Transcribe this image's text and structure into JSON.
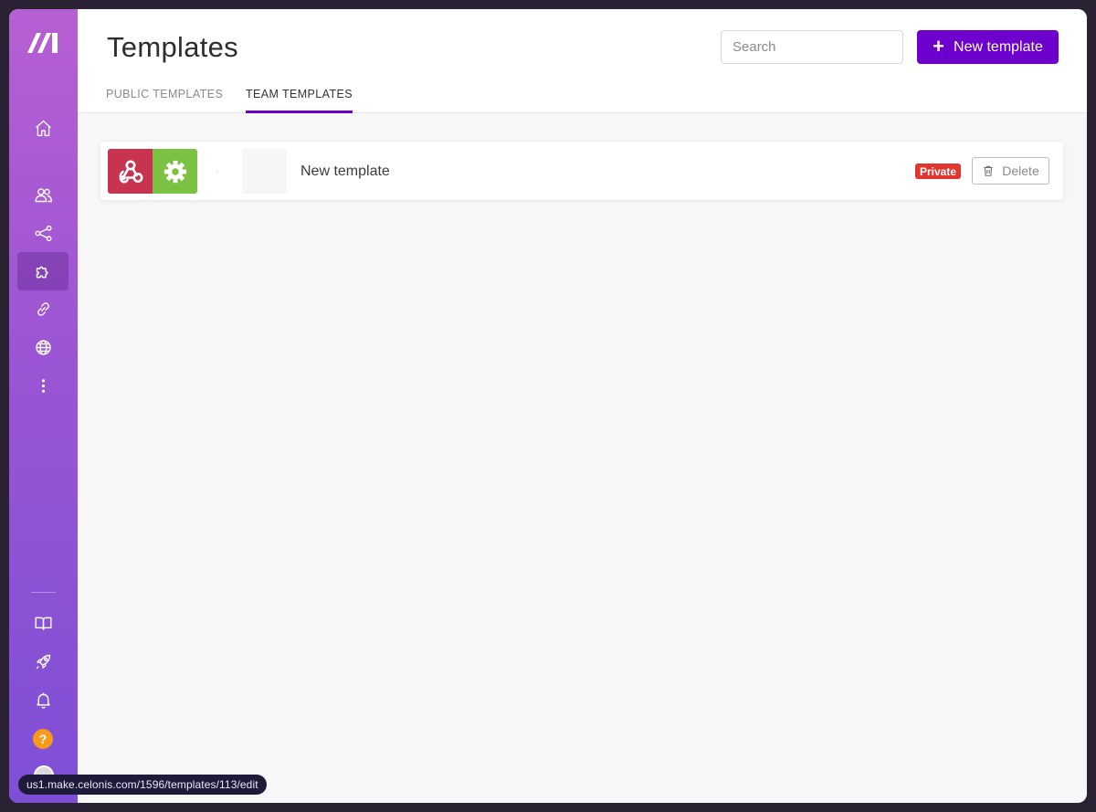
{
  "header": {
    "title": "Templates",
    "search_placeholder": "Search",
    "new_button_label": "New template"
  },
  "tabs": [
    {
      "label": "PUBLIC TEMPLATES",
      "active": false
    },
    {
      "label": "TEAM TEMPLATES",
      "active": true
    }
  ],
  "sidebar": {
    "items": [
      {
        "icon": "home-icon"
      },
      {
        "icon": "team-icon"
      },
      {
        "icon": "scenarios-icon"
      },
      {
        "icon": "templates-puzzle-icon",
        "active": true
      },
      {
        "icon": "connections-link-icon"
      },
      {
        "icon": "webhooks-globe-icon"
      },
      {
        "icon": "more-vertical-icon"
      }
    ],
    "bottom_items": [
      {
        "icon": "docs-book-icon"
      },
      {
        "icon": "rocket-icon"
      },
      {
        "icon": "bell-icon"
      },
      {
        "icon": "help-icon",
        "label": "?"
      }
    ]
  },
  "templates": [
    {
      "name": "New template",
      "apps": [
        "webhooks-icon",
        "tools-gear-icon"
      ],
      "visibility": "Private",
      "delete_label": "Delete"
    }
  ],
  "status_bar": {
    "url": "us1.make.celonis.com/1596/templates/113/edit"
  },
  "colors": {
    "accent": "#6d00cc",
    "private_badge": "#e0362f",
    "webhook_tile": "#c8334f",
    "tools_tile": "#7bc142",
    "help": "#f59a1b"
  }
}
